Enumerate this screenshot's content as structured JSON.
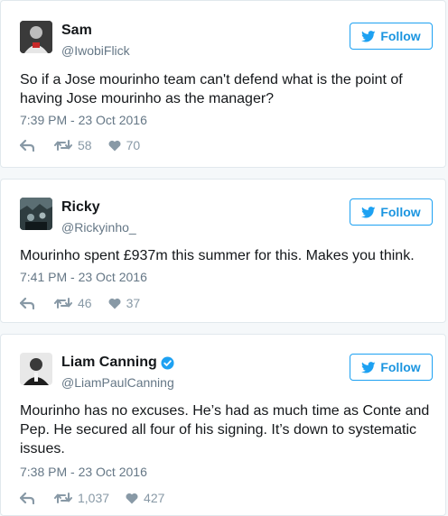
{
  "colors": {
    "accent": "#1da1f2",
    "text": "#14171a",
    "muted": "#657786",
    "action_icons": "#8899a6",
    "verified": "#1da1f2"
  },
  "tweets": [
    {
      "name": "Sam",
      "handle": "@IwobiFlick",
      "follow_label": "Follow",
      "text": "So if a Jose mourinho team can't defend what is the point of having Jose mourinho as the manager?",
      "timestamp": "7:39 PM - 23 Oct 2016",
      "retweets": "58",
      "likes": "70",
      "verified": false,
      "icons": [
        "avatar",
        "twitter-bird-icon",
        "reply-icon",
        "retweet-icon",
        "heart-icon"
      ]
    },
    {
      "name": "Ricky",
      "handle": "@Rickyinho_",
      "follow_label": "Follow",
      "text": "Mourinho spent £937m this summer for this. Makes you think.",
      "timestamp": "7:41 PM - 23 Oct 2016",
      "retweets": "46",
      "likes": "37",
      "verified": false,
      "icons": [
        "avatar",
        "twitter-bird-icon",
        "reply-icon",
        "retweet-icon",
        "heart-icon"
      ]
    },
    {
      "name": "Liam Canning",
      "handle": "@LiamPaulCanning",
      "follow_label": "Follow",
      "text": "Mourinho has no excuses. He’s had as much time as Conte and Pep. He secured all four of his signing. It’s down to systematic issues.",
      "timestamp": "7:38 PM - 23 Oct 2016",
      "retweets": "1,037",
      "likes": "427",
      "verified": true,
      "icons": [
        "avatar",
        "verified-badge-icon",
        "twitter-bird-icon",
        "reply-icon",
        "retweet-icon",
        "heart-icon"
      ]
    }
  ]
}
